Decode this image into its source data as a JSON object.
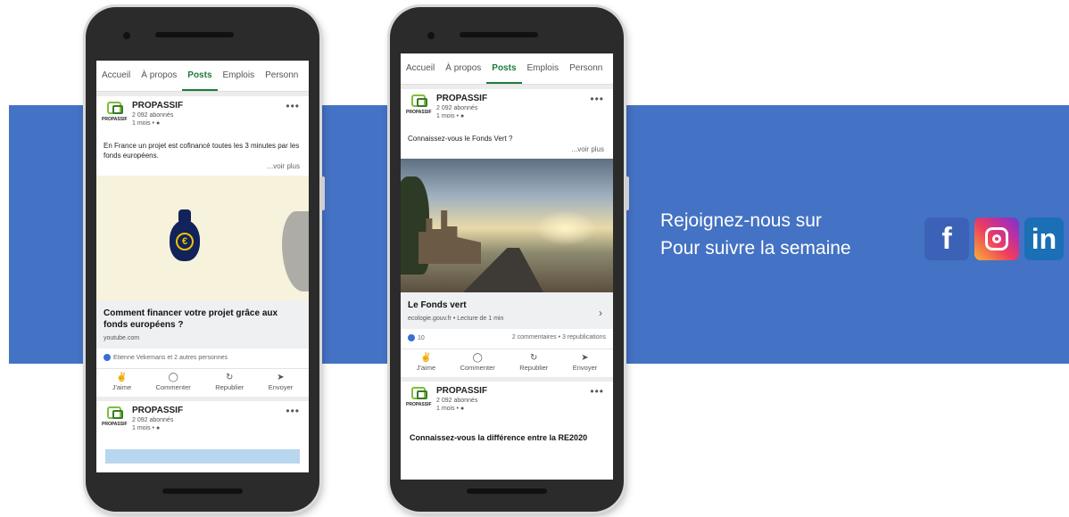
{
  "banner": {
    "line1": "Rejoignez-nous sur",
    "line2": "Pour suivre la semaine",
    "colors": {
      "band": "#4472c4",
      "facebook": "#3b62b6",
      "linkedin": "#1b6fb4"
    },
    "icons": [
      "facebook-icon",
      "instagram-icon",
      "linkedin-icon"
    ]
  },
  "social": {
    "fb_glyph": "f",
    "li_glyph": "in"
  },
  "phone1": {
    "tabs": [
      "Accueil",
      "À propos",
      "Posts",
      "Emplois",
      "Personn"
    ],
    "active_tab": "Posts",
    "post1": {
      "org": "PROPASSIF",
      "logo_word": "PROPASSIF",
      "followers": "2 092 abonnés",
      "time": "1 mois •",
      "text": "En France un projet est cofinancé toutes les 3 minutes par les fonds européens.",
      "voir_plus": "...voir plus",
      "link_title": "Comment financer votre projet grâce aux fonds européens ?",
      "link_src": "youtube.com",
      "reactions": "Etienne Vekemans et 2 autres personnes",
      "actions": [
        "J'aime",
        "Commenter",
        "Republier",
        "Envoyer"
      ],
      "euro": "€"
    },
    "post2": {
      "org": "PROPASSIF",
      "logo_word": "PROPASSIF",
      "followers": "2 092 abonnés",
      "time": "1 mois •"
    }
  },
  "phone2": {
    "tabs": [
      "Accueil",
      "À propos",
      "Posts",
      "Emplois",
      "Personn"
    ],
    "active_tab": "Posts",
    "post1": {
      "org": "PROPASSIF",
      "logo_word": "PROPASSIF",
      "followers": "2 092 abonnés",
      "time": "1 mois •",
      "text": "Connaissez-vous le Fonds Vert ?",
      "voir_plus": "...voir plus",
      "link_title": "Le Fonds vert",
      "link_src": "ecologie.gouv.fr • Lecture de 1 min",
      "likes": "10",
      "stats": "2 commentaires • 3 republications",
      "actions": [
        "J'aime",
        "Commenter",
        "Republier",
        "Envoyer"
      ]
    },
    "post2": {
      "org": "PROPASSIF",
      "logo_word": "PROPASSIF",
      "followers": "2 092 abonnés",
      "time": "1 mois •",
      "teaser": "Connaissez-vous la différence entre la RE2020"
    }
  }
}
